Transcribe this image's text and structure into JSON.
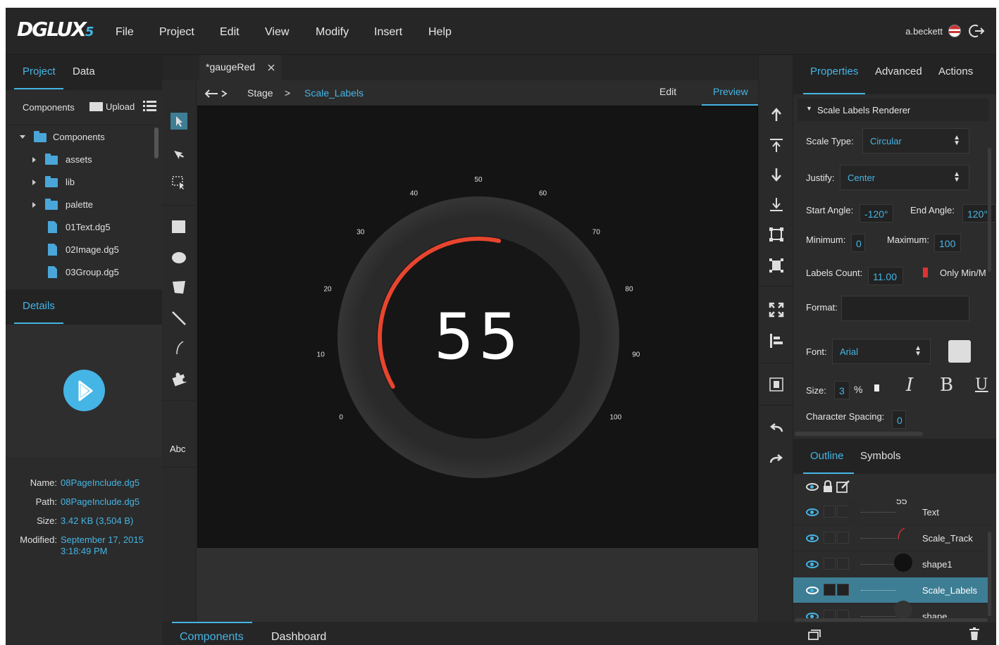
{
  "menubar": {
    "logo_text": "DGLUX",
    "logo_version": "5",
    "items": [
      "File",
      "Project",
      "Edit",
      "View",
      "Modify",
      "Insert",
      "Help"
    ],
    "user": "a.beckett"
  },
  "left_panel": {
    "tabs": [
      "Project",
      "Data"
    ],
    "toolbar": {
      "label": "Components",
      "upload_label": "Upload"
    },
    "tree": [
      {
        "label": "Components",
        "type": "folder",
        "expanded": true
      },
      {
        "label": "assets",
        "type": "folder"
      },
      {
        "label": "lib",
        "type": "folder"
      },
      {
        "label": "palette",
        "type": "folder"
      },
      {
        "label": "01Text.dg5",
        "type": "file"
      },
      {
        "label": "02Image.dg5",
        "type": "file"
      },
      {
        "label": "03Group.dg5",
        "type": "file"
      }
    ],
    "details_tab": "Details",
    "details": [
      {
        "label": "Name:",
        "value": "08PageInclude.dg5"
      },
      {
        "label": "Path:",
        "value": "08PageInclude.dg5"
      },
      {
        "label": "Size:",
        "value": "3.42 KB (3,504 B)"
      },
      {
        "label": "Modified:",
        "value": "September 17, 2015",
        "value2": "3:18:49 PM"
      }
    ]
  },
  "tools": {
    "text_tool_label": "Abc"
  },
  "center": {
    "doc_tab": "*gaugeRed",
    "breadcrumb": {
      "stage": "Stage",
      "separator": ">",
      "current": "Scale_Labels"
    },
    "modes": [
      "Edit",
      "Preview"
    ],
    "active_mode": "Preview",
    "gauge": {
      "value": "55",
      "min": 0,
      "max": 100,
      "start_angle": -120,
      "end_angle": 120,
      "fill_fraction": 0.55,
      "labels": [
        "0",
        "10",
        "20",
        "30",
        "40",
        "50",
        "60",
        "70",
        "80",
        "90",
        "100"
      ],
      "track_color": "#e8452e"
    },
    "bottom_tabs": [
      "Components",
      "Dashboard"
    ]
  },
  "properties": {
    "tabs": [
      "Properties",
      "Advanced",
      "Actions"
    ],
    "section": "Scale Labels Renderer",
    "scale_type_label": "Scale Type:",
    "scale_type": "Circular",
    "justify_label": "Justify:",
    "justify": "Center",
    "start_angle_label": "Start Angle:",
    "start_angle": "-120°",
    "end_angle_label": "End Angle:",
    "end_angle": "120°",
    "minimum_label": "Minimum:",
    "minimum": "0",
    "maximum_label": "Maximum:",
    "maximum": "100",
    "labels_count_label": "Labels Count:",
    "labels_count": "11.00",
    "only_minmax_label": "Only Min/M",
    "format_label": "Format:",
    "format": "",
    "font_label": "Font:",
    "font": "Arial",
    "size_label": "Size:",
    "size": "3",
    "size_unit": "%",
    "style_buttons": [
      "I",
      "B",
      "U"
    ],
    "char_spacing_label": "Character Spacing:",
    "char_spacing": "0"
  },
  "outline": {
    "tabs": [
      "Outline",
      "Symbols"
    ],
    "rows": [
      {
        "label": "Text",
        "thumb": "55"
      },
      {
        "label": "Scale_Track"
      },
      {
        "label": "shape1"
      },
      {
        "label": "Scale_Labels",
        "selected": true
      },
      {
        "label": "shape"
      }
    ]
  }
}
